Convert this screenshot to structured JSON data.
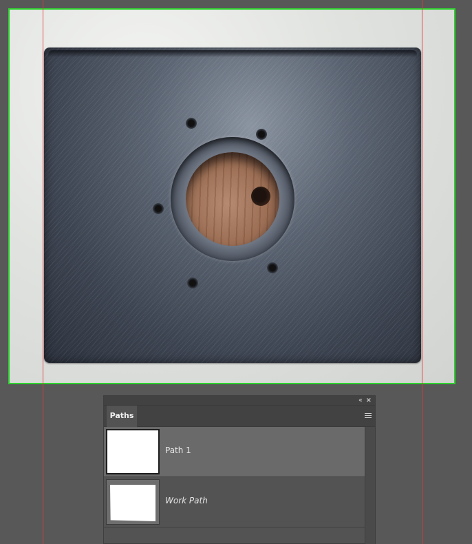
{
  "panel": {
    "tab_label": "Paths",
    "collapse_icon": "double-chevron-left-icon",
    "close_icon": "close-icon",
    "menu_icon": "hamburger-menu-icon",
    "paths": [
      {
        "label": "Path 1",
        "selected": true
      },
      {
        "label": "Work Path",
        "selected": false
      }
    ]
  },
  "colors": {
    "selection_border": "#2fd12f",
    "guide": "#e23b3b",
    "panel_bg": "#535353",
    "selected_row": "#6a6a6a"
  }
}
